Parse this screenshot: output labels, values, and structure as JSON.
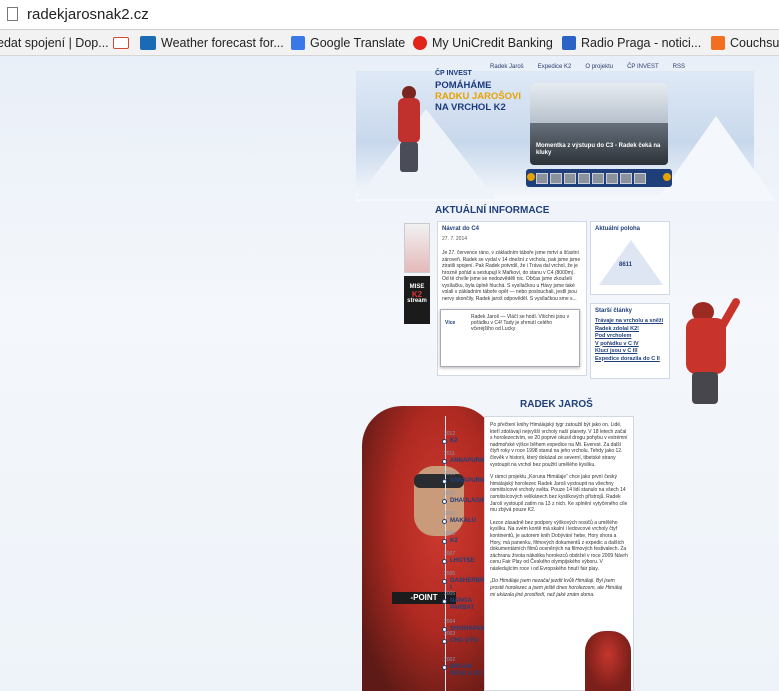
{
  "browser": {
    "url": "radekjarosnak2.cz",
    "bookmarks": [
      {
        "label": "edat spojení | Dop...",
        "icon": "page-icon",
        "color": "#999999"
      },
      {
        "label": "",
        "icon": "gmail-icon",
        "color": "#d14836"
      },
      {
        "label": "Weather forecast for...",
        "icon": "yr-icon",
        "color": "#1a6bb3"
      },
      {
        "label": "Google Translate",
        "icon": "translate-icon",
        "color": "#3b78e7"
      },
      {
        "label": "My UniCredit Banking",
        "icon": "unicredit-icon",
        "color": "#e2231a"
      },
      {
        "label": "Radio Praga - notici...",
        "icon": "radio-icon",
        "color": "#2b63c4"
      },
      {
        "label": "Couchsu",
        "icon": "couchsurfing-icon",
        "color": "#f26f21"
      }
    ]
  },
  "site": {
    "nav": [
      "Radek Jaroš",
      "Expedice K2",
      "O projektu",
      "ČP INVEST",
      "RSS"
    ],
    "brand": {
      "logo": "ČP INVEST",
      "line1": "POMÁHÁME",
      "line2": "RADKU JAROŠOVI",
      "line3": "NA VRCHOL K2"
    },
    "video_caption": "Momentka z výstupu do C3 - Radek čeká na kluky",
    "news": {
      "title": "AKTUÁLNÍ INFORMACE",
      "heading": "Návrat do C4",
      "date": "27. 7. 2014",
      "text": "Je 27. července ráno, v základním táboře jsme mrtví a šťastní zároveň. Radek se vydal v 14 dnešní z vrcholu, pak jsme jsme ztratili spojení. Pak Radek potvrdil, že i Tráva dal vrchol, že je hrozně pořád a sestupují k Mařkovi, do stanu v C4 (8000m). Od té chvíle jsme se nedozvěděli nic. Občas jsme zkoušeli vysílačku, byla úplně hluchá. S vysílačkou u Hávy jsme také volali v základním táboře opět — nebo poslouchali, jestli jsou nervy skončily, Radek jaroš odpověděl. S vysílačkou sme s...",
      "popup_text": "Radek Jaroš — Vláčí se hodí. Všichni jsou v pořádku v C4! Tady je shrnutí celého včerejšího od Lucky",
      "more": "Více"
    },
    "banners": {
      "banner2_line1": "MISE",
      "banner2_line2": "K2",
      "banner2_line3": "stream"
    },
    "location": {
      "title": "Aktuální poloha",
      "altitude": "8611"
    },
    "articles": {
      "title": "Starší články",
      "items": [
        "Trávaje na vrcholu a sněží",
        "Radek zdolal K2!",
        "Pod vrcholem",
        "V pořádku v C IV",
        "Klucí jsou v C III",
        "Expedice dorazila do C II"
      ]
    },
    "bio": {
      "title": "RADEK JAROŠ",
      "logo_on_jacket": "-POINT",
      "paragraphs": [
        "Po přečtení knihy Himálajský tygr zatoužil být jako on. Lidé, kteří zdolávají nejvyšší vrcholy naší planety. V 18 letech začal s horolezectvím, ve 20 poprvé okusil drogu pohybu v extrémní nadmořské výšce během expedice na Mt. Everest. Za další čtyři roky v roce 1998 stanul na jeho vrcholu. Tehdy jako 12. člověk v historii, který dokázal ze severní, tibetské strany vystoupit na vrchol bez použití umělého kyslíku.",
        "V rámci projektu „Koruna Himálaje“ chce jako první český himálajský horolezec Radek Jaroš vystoupit na všechny osmitisícové vrcholy světa. Pouze 14 lidí stanulo na všech 14 osmitisícových velikánech bez kyslíkových přístrojů. Radek Jaroš vystoupil zatím na 13 z nich. Ke splnění vytyčeného cíle mu zbývá pouze K2.",
        "Lezce zásadně bez podpory výškových nosičů a umělého kyslíku. Na svém kontě má skalní i ledovcové vrcholy čtyř kontinentů, je autorem knih Dobývání hebe, Hory shora a Hory, má panenku, filmových dokumentů z expedic a dalších dokumentárních filmů oceněných na filmových festivalech. Za záchranu života nákolika horolezců obdržel v roce 2009 Návrh cenu Fair Play od Českého olympijského výboru. V následujícím roce i od Evropského hnutí fair play.",
        "„Do Himálaje jsem nezačal jezdit kvůli Himálaji. Byl jsem prostě horolezec a jsem ještě dnes horolezcem, ale Himálaj mi ukázala jiné prostředí, než jaké znám doma."
      ]
    },
    "timeline": [
      {
        "year": "2012",
        "label": "K2"
      },
      {
        "year": "2011",
        "label": "ANNAPURNA"
      },
      {
        "year": "2010",
        "label": "ANNAPURNA"
      },
      {
        "year": "2009",
        "label": "DHAULAGIRI"
      },
      {
        "year": "2009",
        "label": "MAKALU"
      },
      {
        "year": "2008",
        "label": "K2"
      },
      {
        "year": "2007",
        "label": "LHOTSE"
      },
      {
        "year": "2005",
        "label": "GASHERBRUM I"
      },
      {
        "year": "2005",
        "label": "NANGA PARBAT"
      },
      {
        "year": "2004",
        "label": "SHISHAPANGMA"
      },
      {
        "year": "2003",
        "label": "CHO OYU"
      },
      {
        "year": "2002",
        "label": "BROAD PEAK A K2"
      }
    ]
  }
}
